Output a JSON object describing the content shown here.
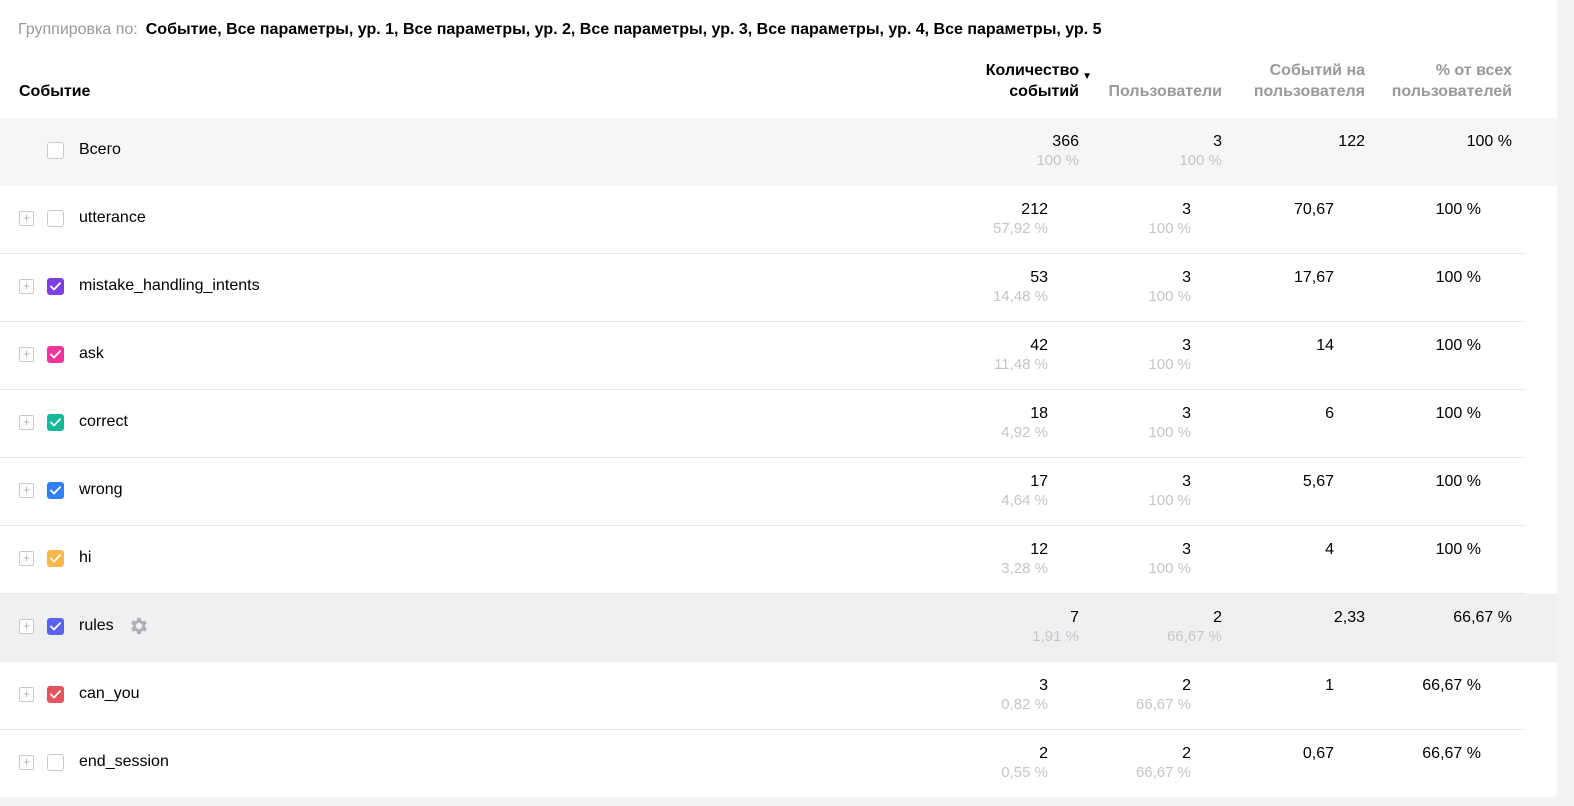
{
  "grouping": {
    "label": "Группировка по:",
    "value": "Событие, Все параметры, ур. 1, Все параметры, ур. 2, Все параметры, ур. 3, Все параметры, ур. 4, Все параметры, ур. 5"
  },
  "columns": {
    "event": "Событие",
    "count": "Количество событий",
    "users": "Пользователи",
    "per_user": "Событий на пользователя",
    "pct_all": "% от всех пользователей"
  },
  "sort_icon": "sort-desc-icon",
  "rows": [
    {
      "name": "Всего",
      "total": true,
      "checked": false,
      "color": "",
      "count": "366",
      "count_pct": "100 %",
      "users": "3",
      "users_pct": "100 %",
      "per_user": "122",
      "pct_all": "100 %"
    },
    {
      "name": "utterance",
      "checked": false,
      "color": "",
      "count": "212",
      "count_pct": "57,92 %",
      "users": "3",
      "users_pct": "100 %",
      "per_user": "70,67",
      "pct_all": "100 %"
    },
    {
      "name": "mistake_handling_intents",
      "checked": true,
      "color": "#7b3fe4",
      "count": "53",
      "count_pct": "14,48 %",
      "users": "3",
      "users_pct": "100 %",
      "per_user": "17,67",
      "pct_all": "100 %"
    },
    {
      "name": "ask",
      "checked": true,
      "color": "#f0349d",
      "count": "42",
      "count_pct": "11,48 %",
      "users": "3",
      "users_pct": "100 %",
      "per_user": "14",
      "pct_all": "100 %"
    },
    {
      "name": "correct",
      "checked": true,
      "color": "#16b89a",
      "count": "18",
      "count_pct": "4,92 %",
      "users": "3",
      "users_pct": "100 %",
      "per_user": "6",
      "pct_all": "100 %"
    },
    {
      "name": "wrong",
      "checked": true,
      "color": "#2f80f4",
      "count": "17",
      "count_pct": "4,64 %",
      "users": "3",
      "users_pct": "100 %",
      "per_user": "5,67",
      "pct_all": "100 %"
    },
    {
      "name": "hi",
      "checked": true,
      "color": "#f7b84b",
      "count": "12",
      "count_pct": "3,28 %",
      "users": "3",
      "users_pct": "100 %",
      "per_user": "4",
      "pct_all": "100 %"
    },
    {
      "name": "rules",
      "checked": true,
      "hover": true,
      "color": "#5b63ee",
      "count": "7",
      "count_pct": "1,91 %",
      "users": "2",
      "users_pct": "66,67 %",
      "per_user": "2,33",
      "pct_all": "66,67 %"
    },
    {
      "name": "can_you",
      "checked": true,
      "color": "#e5535f",
      "count": "3",
      "count_pct": "0,82 %",
      "users": "2",
      "users_pct": "66,67 %",
      "per_user": "1",
      "pct_all": "66,67 %"
    },
    {
      "name": "end_session",
      "checked": false,
      "color": "",
      "count": "2",
      "count_pct": "0,55 %",
      "users": "2",
      "users_pct": "66,67 %",
      "per_user": "0,67",
      "pct_all": "66,67 %"
    }
  ]
}
